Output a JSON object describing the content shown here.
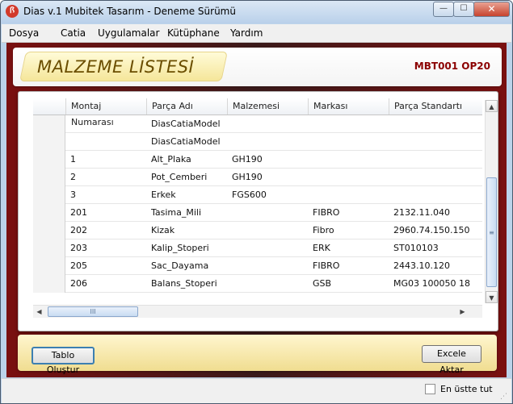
{
  "window": {
    "title": "Dias v.1 Mubitek Tasarım - Deneme Sürümü",
    "icon": "dias-logo-icon"
  },
  "window_controls": {
    "minimize": "—",
    "maximize": "☐",
    "close": "✕"
  },
  "menu": [
    "Dosya",
    "Catia",
    "Uygulamalar",
    "Kütüphane",
    "Yardım"
  ],
  "banner": {
    "title": "MALZEME LİSTESİ",
    "code": "MBT001 OP20"
  },
  "table": {
    "columns": [
      "Montaj Numarası",
      "Parça Adı",
      "Malzemesi",
      "Markası",
      "Parça Standartı"
    ],
    "rows": [
      [
        "",
        "DiasCatiaModel",
        "",
        "",
        ""
      ],
      [
        "",
        "DiasCatiaModel",
        "",
        "",
        ""
      ],
      [
        "1",
        "Alt_Plaka",
        "GH190",
        "",
        ""
      ],
      [
        "2",
        "Pot_Cemberi",
        "GH190",
        "",
        ""
      ],
      [
        "3",
        "Erkek",
        "FGS600",
        "",
        ""
      ],
      [
        "201",
        "Tasima_Mili",
        "",
        "FIBRO",
        "2132.11.040"
      ],
      [
        "202",
        "Kizak",
        "",
        "Fibro",
        "2960.74.150.150"
      ],
      [
        "203",
        "Kalip_Stoperi",
        "",
        "ERK",
        "ST010103"
      ],
      [
        "205",
        "Sac_Dayama",
        "",
        "FIBRO",
        "2443.10.120"
      ],
      [
        "206",
        "Balans_Stoperi",
        "",
        "GSB",
        "MG03 100050 18"
      ]
    ]
  },
  "scroll": {
    "up": "▲",
    "down": "▼",
    "left": "◀",
    "right": "▶",
    "grip_v": "≡",
    "grip_h": "III"
  },
  "buttons": {
    "create_table": "Tablo Oluştur",
    "export_excel": "Excele Aktar"
  },
  "status": {
    "always_on_top": "En üstte tut",
    "always_on_top_checked": false
  }
}
